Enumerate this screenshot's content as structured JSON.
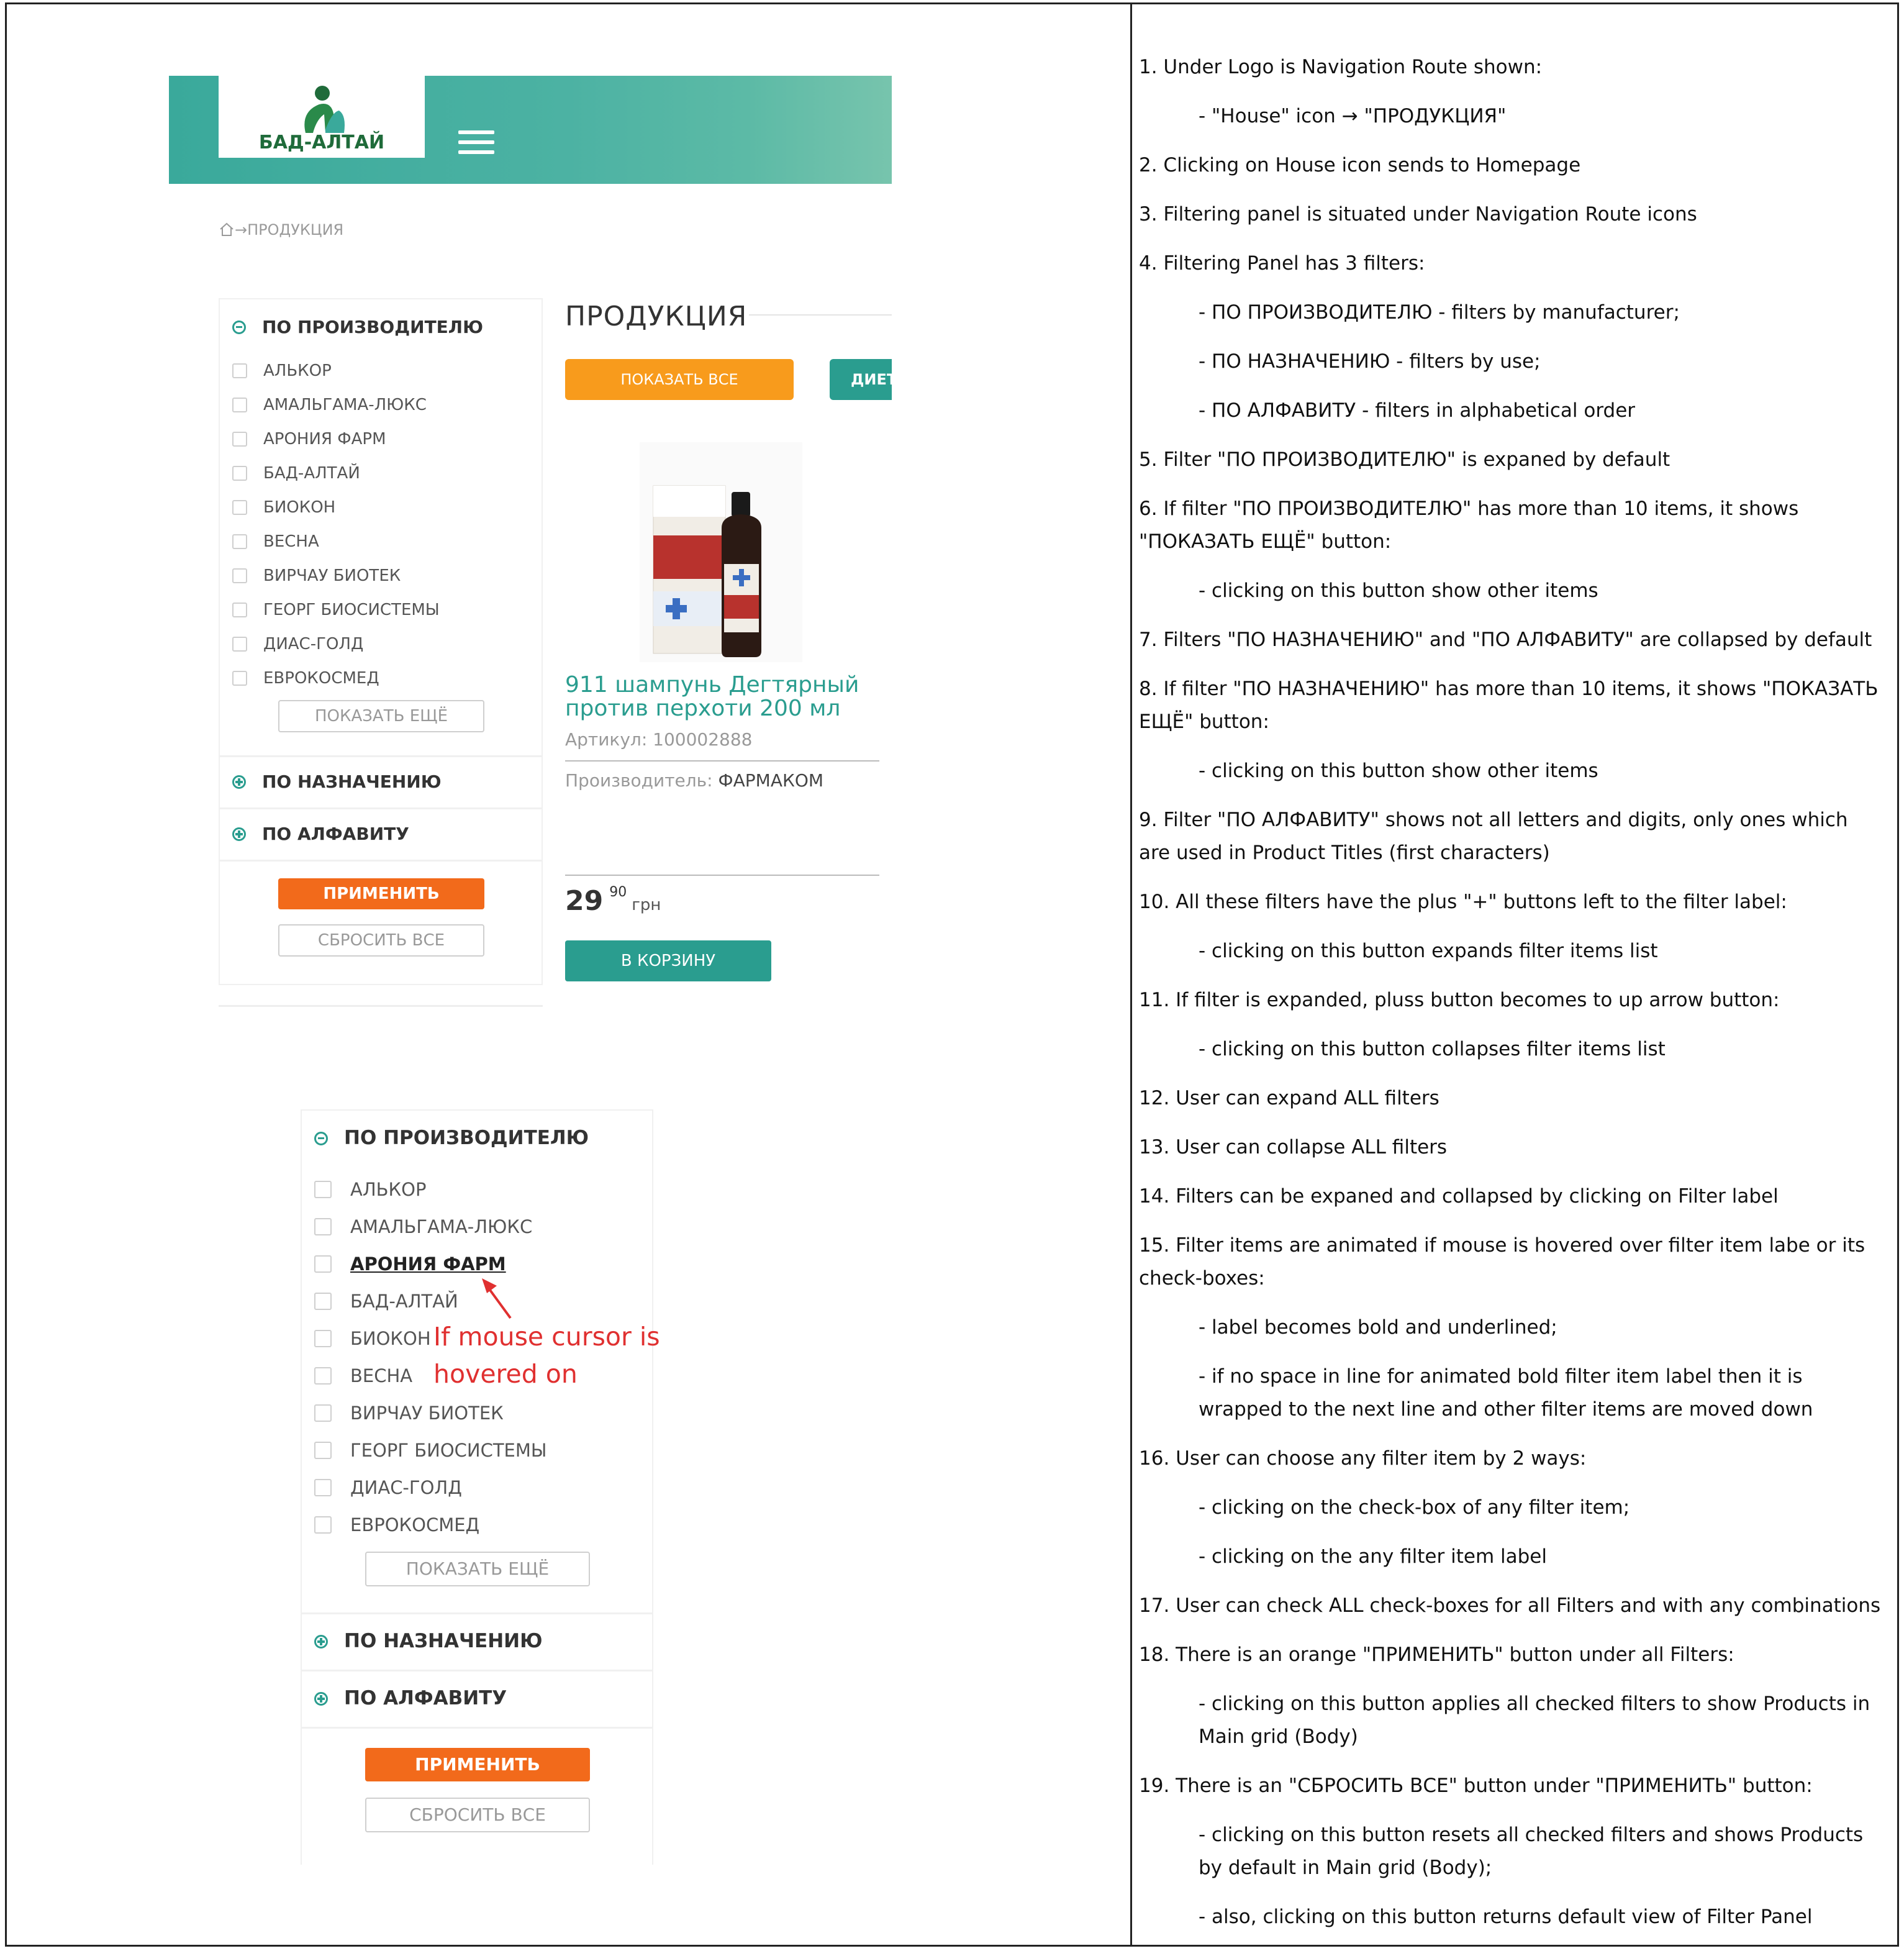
{
  "brand": {
    "logo_text": "БАД-АЛТАЙ",
    "primary": "#2a9d8f",
    "orange": "#f26a1b",
    "yellow_orange": "#f89b1c"
  },
  "breadcrumb": {
    "separator": "→",
    "current": "ПРОДУКЦИЯ"
  },
  "filters": {
    "manufacturer": "ПО ПРОИЗВОДИТЕЛЮ",
    "purpose": "ПО НАЗНАЧЕНИЮ",
    "alphabet": "ПО АЛФАВИТУ",
    "items": [
      "АЛЬКОР",
      "АМАЛЬГАМА-ЛЮКС",
      "АРОНИЯ ФАРМ",
      "БАД-АЛТАЙ",
      "БИОКОН",
      "ВЕСНА",
      "ВИРЧАУ БИОТЕК",
      "ГЕОРГ БИОСИСТЕМЫ",
      "ДИАС-ГОЛД",
      "ЕВРОКОСМЕД"
    ],
    "show_more": "ПОКАЗАТЬ ЕЩЁ",
    "apply": "ПРИМЕНИТЬ",
    "reset": "СБРОСИТЬ ВСЕ"
  },
  "catalog": {
    "title": "ПРОДУКЦИЯ",
    "show_all": "ПОКАЗАТЬ ВСЕ",
    "diet_tab": "ДИЕТ",
    "product": {
      "name": "911 шампунь Дегтярный против перхоти 200 мл",
      "article": "Артикул: 100002888",
      "maker_label": "Производитель:",
      "maker": "ФАРМАКОМ",
      "price_int": "29",
      "price_dec": "90",
      "currency": "грн",
      "cart": "В КОРЗИНУ"
    }
  },
  "annotation": {
    "line1": "If mouse cursor is",
    "line2": "hovered on"
  },
  "requirements": [
    "1. Under Logo is Navigation Route shown:",
    "- \"House\" icon → \"ПРОДУКЦИЯ\"",
    "2. Clicking on House icon sends to Homepage",
    "3. Filtering panel is situated under Navigation Route icons",
    "4. Filtering Panel has 3 filters:",
    "- ПО ПРОИЗВОДИТЕЛЮ - filters by manufacturer;",
    "- ПО НАЗНАЧЕНИЮ - filters by use;",
    "- ПО АЛФАВИТУ - filters in alphabetical order",
    "5. Filter \"ПО ПРОИЗВОДИТЕЛЮ\" is expaned by default",
    "6. If filter \"ПО ПРОИЗВОДИТЕЛЮ\" has more than 10 items, it shows \"ПОКАЗАТЬ ЕЩЁ\" button:",
    "- clicking on this button show other items",
    "7. Filters \"ПО НАЗНАЧЕНИЮ\" and \"ПО АЛФАВИТУ\" are collapsed by default",
    "8. If filter \"ПО НАЗНАЧЕНИЮ\" has more than 10 items, it shows \"ПОКАЗАТЬ ЕЩЁ\" button:",
    "- clicking on this button show other items",
    "9. Filter \"ПО АЛФАВИТУ\" shows not all letters and digits, only ones which are used in Product Titles (first characters)",
    "10. All these filters have the plus \"+\" buttons left to the filter label:",
    "- clicking on this button expands filter items list",
    "11. If filter is expanded, pluss button becomes to up arrow button:",
    "- clicking on this button collapses filter items list",
    "12. User can expand ALL filters",
    "13. User can collapse ALL filters",
    "14. Filters can be expaned and collapsed by clicking on Filter label",
    "15. Filter items are animated if mouse is hovered over filter item labe or its check-boxes:",
    "- label becomes bold and underlined;",
    "- if no space in line for animated bold filter item label then it is wrapped to the next line and other filter items are moved down",
    "16. User can choose any filter item by 2 ways:",
    "- clicking on the check-box of any filter item;",
    "- clicking on the any filter item label",
    "17. User can check ALL check-boxes for all Filters and with any combinations",
    "18. There is an orange \"ПРИМЕНИТЬ\" button under all Filters:",
    "- clicking on this button applies all checked filters to show Products in Main grid (Body)",
    "19. There is an \"СБРОСИТЬ ВСЕ\" button under \"ПРИМЕНИТЬ\" button:",
    "- clicking on this button resets all checked filters and shows Products by default  in Main grid (Body);",
    "- also, clicking on this button returns default view of Filter Panel"
  ]
}
